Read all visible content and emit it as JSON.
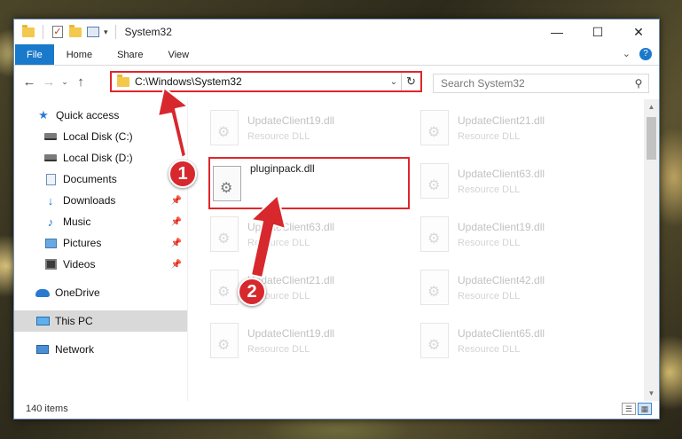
{
  "window": {
    "title": "System32",
    "controls": {
      "minimize": "—",
      "maximize": "☐",
      "close": "✕"
    }
  },
  "ribbon": {
    "tabs": [
      "File",
      "Home",
      "Share",
      "View"
    ],
    "collapse": "⌄",
    "help": "?"
  },
  "address": {
    "path": "C:\\Windows\\System32",
    "search_placeholder": "Search System32"
  },
  "nav": {
    "items": [
      {
        "label": "Quick access",
        "icon": "star-icon"
      },
      {
        "label": "Local Disk (C:)",
        "icon": "drive-icon"
      },
      {
        "label": "Local Disk (D:)",
        "icon": "drive-icon"
      },
      {
        "label": "Documents",
        "icon": "documents-icon",
        "pinned": true
      },
      {
        "label": "Downloads",
        "icon": "downloads-icon",
        "pinned": true
      },
      {
        "label": "Music",
        "icon": "music-icon",
        "pinned": true
      },
      {
        "label": "Pictures",
        "icon": "pictures-icon",
        "pinned": true
      },
      {
        "label": "Videos",
        "icon": "videos-icon",
        "pinned": true
      },
      {
        "label": "OneDrive",
        "icon": "onedrive-icon"
      },
      {
        "label": "This PC",
        "icon": "this-pc-icon",
        "selected": true
      },
      {
        "label": "Network",
        "icon": "network-icon"
      }
    ]
  },
  "files": [
    {
      "name": "UpdateClient19.dll",
      "type": "Resource DLL"
    },
    {
      "name": "UpdateClient21.dll",
      "type": "Resource DLL"
    },
    {
      "name": "pluginpack.dll",
      "type": "",
      "highlighted": true
    },
    {
      "name": "UpdateClient63.dll",
      "type": "Resource DLL"
    },
    {
      "name": "UpdateClient63.dll",
      "type": "Resource DLL"
    },
    {
      "name": "UpdateClient19.dll",
      "type": "Resource DLL"
    },
    {
      "name": "UpdateClient21.dll",
      "type": "Resource DLL"
    },
    {
      "name": "UpdateClient42.dll",
      "type": "Resource DLL"
    },
    {
      "name": "UpdateClient19.dll",
      "type": "Resource DLL"
    },
    {
      "name": "UpdateClient65.dll",
      "type": "Resource DLL"
    }
  ],
  "status": {
    "item_count": "140 items"
  },
  "annotations": {
    "step1": "1",
    "step2": "2"
  },
  "colors": {
    "accent": "#1979ca",
    "highlight": "#e0262b",
    "badge": "#d7282d"
  }
}
